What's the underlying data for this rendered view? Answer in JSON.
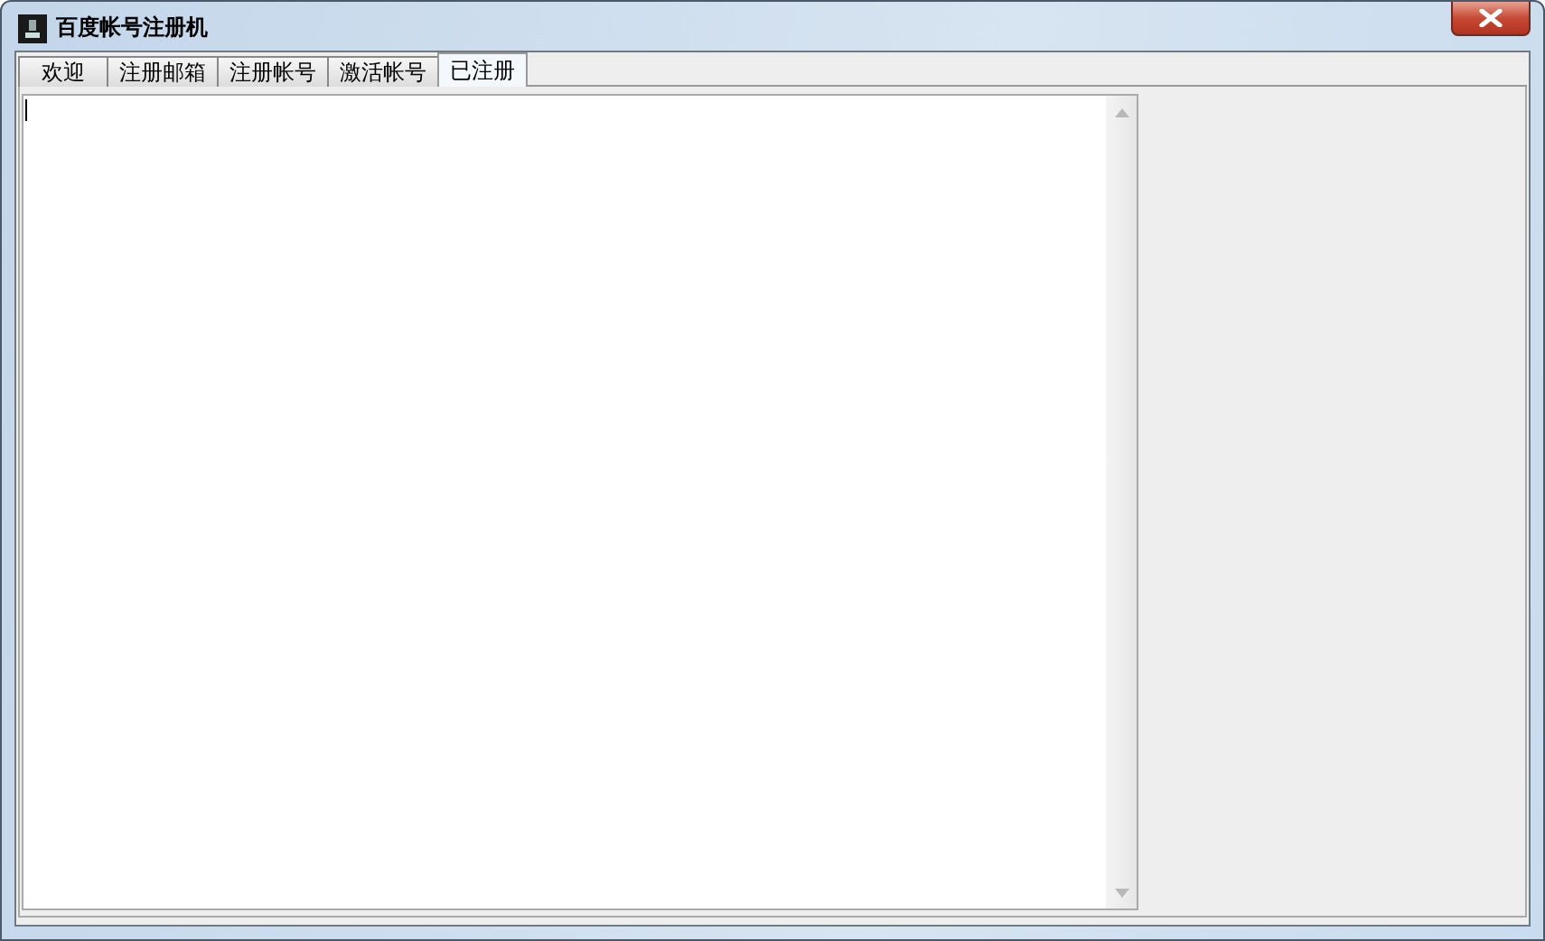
{
  "window": {
    "title": "百度帐号注册机"
  },
  "tabs": [
    {
      "label": "欢迎",
      "selected": false
    },
    {
      "label": "注册邮箱",
      "selected": false
    },
    {
      "label": "注册帐号",
      "selected": false
    },
    {
      "label": "激活帐号",
      "selected": false
    },
    {
      "label": "已注册",
      "selected": true
    }
  ]
}
